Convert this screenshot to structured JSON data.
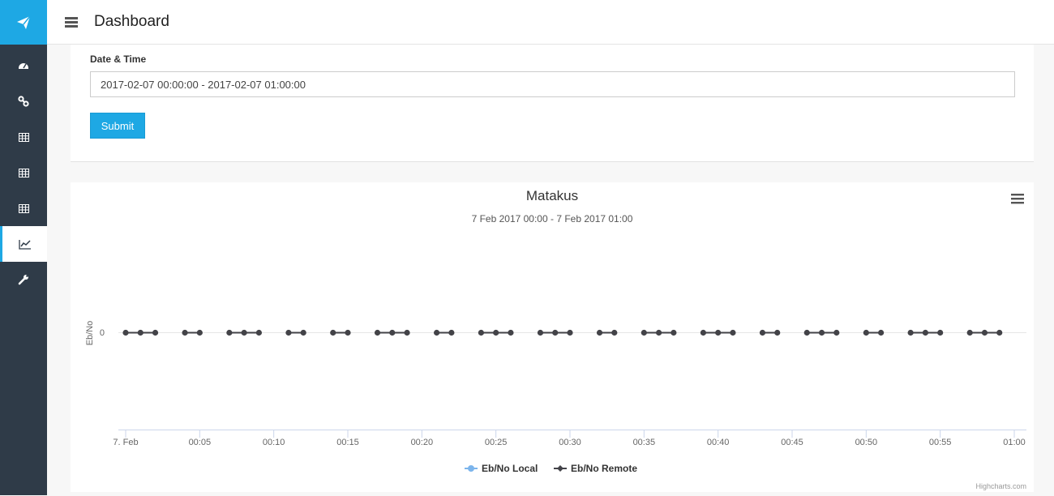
{
  "app": {
    "title": "Dashboard"
  },
  "sidebar": {
    "logo_icon": "paper-plane-icon",
    "items": [
      {
        "icon": "dashboard-icon",
        "active": false
      },
      {
        "icon": "link-icon",
        "active": false
      },
      {
        "icon": "table-icon",
        "active": false
      },
      {
        "icon": "table-icon",
        "active": false
      },
      {
        "icon": "table-icon",
        "active": false
      },
      {
        "icon": "line-chart-icon",
        "active": true
      },
      {
        "icon": "wrench-icon",
        "active": false
      }
    ]
  },
  "form": {
    "label": "Date & Time",
    "date_value": "2017-02-07 00:00:00 - 2017-02-07 01:00:00",
    "submit_label": "Submit"
  },
  "colors": {
    "accent": "#1ea8e4",
    "sidebar": "#2f3b48",
    "series_local": "#7cb5ec",
    "series_remote": "#434348"
  },
  "chart_data": {
    "type": "line",
    "title": "Matakus",
    "subtitle": "7 Feb 2017 00:00 - 7 Feb 2017 01:00",
    "ylabel": "Eb/No",
    "xlabel": "",
    "y_ticks": [
      "0"
    ],
    "x_tick_minutes": [
      0,
      5,
      10,
      15,
      20,
      25,
      30,
      35,
      40,
      45,
      50,
      55,
      60
    ],
    "x_tick_labels": [
      "7. Feb",
      "00:05",
      "00:10",
      "00:15",
      "00:20",
      "00:25",
      "00:30",
      "00:35",
      "00:40",
      "00:45",
      "00:50",
      "00:55",
      "01:00"
    ],
    "xlim_minutes": [
      0,
      60
    ],
    "legend": {
      "placement": "bottom-center"
    },
    "credits": "Highcharts.com",
    "series": [
      {
        "name": "Eb/No Local",
        "color": "#7cb5ec",
        "segments": []
      },
      {
        "name": "Eb/No Remote",
        "color": "#434348",
        "segments": [
          {
            "x": [
              0,
              1,
              2
            ],
            "y": [
              0,
              0,
              0
            ]
          },
          {
            "x": [
              4,
              5
            ],
            "y": [
              0,
              0
            ]
          },
          {
            "x": [
              7,
              8,
              9
            ],
            "y": [
              0,
              0,
              0
            ]
          },
          {
            "x": [
              11,
              12
            ],
            "y": [
              0,
              0
            ]
          },
          {
            "x": [
              14,
              15
            ],
            "y": [
              0,
              0
            ]
          },
          {
            "x": [
              17,
              18,
              19
            ],
            "y": [
              0,
              0,
              0
            ]
          },
          {
            "x": [
              21,
              22
            ],
            "y": [
              0,
              0
            ]
          },
          {
            "x": [
              24,
              25,
              26
            ],
            "y": [
              0,
              0,
              0
            ]
          },
          {
            "x": [
              28,
              29,
              30
            ],
            "y": [
              0,
              0,
              0
            ]
          },
          {
            "x": [
              32,
              33
            ],
            "y": [
              0,
              0
            ]
          },
          {
            "x": [
              35,
              36,
              37
            ],
            "y": [
              0,
              0,
              0
            ]
          },
          {
            "x": [
              39,
              40,
              41
            ],
            "y": [
              0,
              0,
              0
            ]
          },
          {
            "x": [
              43,
              44
            ],
            "y": [
              0,
              0
            ]
          },
          {
            "x": [
              46,
              47,
              48
            ],
            "y": [
              0,
              0,
              0
            ]
          },
          {
            "x": [
              50,
              51
            ],
            "y": [
              0,
              0
            ]
          },
          {
            "x": [
              53,
              54,
              55
            ],
            "y": [
              0,
              0,
              0
            ]
          },
          {
            "x": [
              57,
              58,
              59
            ],
            "y": [
              0,
              0,
              0
            ]
          }
        ]
      }
    ]
  }
}
